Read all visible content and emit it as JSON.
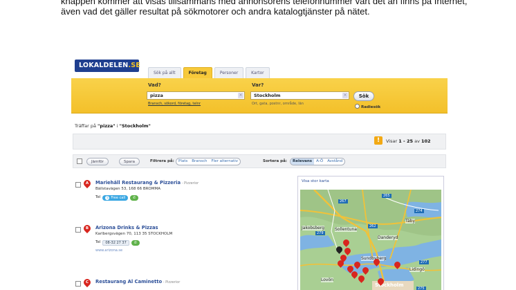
{
  "doc_text": "knappen kommer att visas tillsammans med annonsörens telefonnummer vart det än finns på Internet, även vad det gäller resultat på sökmotorer och andra katalogtjänster på nätet.",
  "logo": {
    "main": "LOKALDELEN",
    "tld": ".SE"
  },
  "tabs": [
    "Sök på allt",
    "Företag",
    "Personer",
    "Kartor"
  ],
  "search": {
    "what_label": "Vad?",
    "what_value": "pizza",
    "what_hint": "Bransch, sökord, företag, telnr",
    "where_label": "Var?",
    "where_value": "Stockholm",
    "where_hint": "Ort, gata, postnr, område, län",
    "button": "Sök",
    "radius": "Radiesök"
  },
  "hits_text": {
    "prefix": "Träffar på ",
    "q1": "\"pizza\"",
    "mid": " i ",
    "q2": "\"Stockholm\""
  },
  "count": {
    "prefix": "Visar ",
    "range": "1 - 25",
    "mid": " av ",
    "total": "102"
  },
  "toolbar": {
    "compare": "Jämför",
    "save": "Spara",
    "filter_label": "Filtrera på:",
    "filters": [
      "Plats",
      "Bransch",
      "Fler alternativ"
    ],
    "sort_label": "Sortera på:",
    "sorts": [
      "Relevans",
      "A-Ö",
      "Avstånd"
    ]
  },
  "results": [
    {
      "letter": "A",
      "name": "Mariehäll Restaurang & Pizzeria",
      "category": " - Pizzerior",
      "address": "Bällstavägen 53, 168 66 BROMMA",
      "tel_label": "Tel",
      "tel_button": "Free call",
      "web": ""
    },
    {
      "letter": "B",
      "name": "Arizona Drinks & Pizzas",
      "category": "",
      "address": "Karlbergsvägen 70, 113 35 STOCKHOLM",
      "tel_label": "Tel",
      "tel_button": "08-32 27 37",
      "web": "www.arizona.se"
    },
    {
      "letter": "C",
      "name": "Restaurang Al Caminetto",
      "category": " - Pizzerior",
      "address": "",
      "tel_label": "",
      "tel_button": "",
      "web": ""
    }
  ],
  "map": {
    "link": "Visa stor karta",
    "places": [
      "Jakobsberg",
      "Sollentuna",
      "Täby",
      "Danderyd",
      "Sundbyberg",
      "Lidingö",
      "Lovön",
      "Stockholm"
    ],
    "road_numbers": [
      "267",
      "265",
      "274",
      "262",
      "279",
      "277",
      "275"
    ]
  },
  "colors": {
    "brand": "#1f3f8f",
    "accent": "#f3c02a",
    "pin": "#d8251e",
    "link": "#2c4f98"
  }
}
